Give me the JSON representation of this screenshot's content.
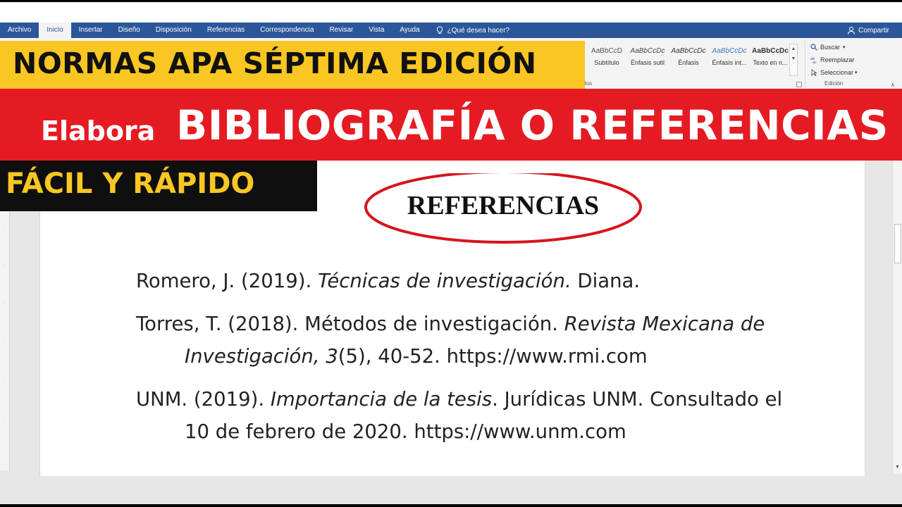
{
  "ribbon": {
    "tabs": [
      "Archivo",
      "Inicio",
      "Insertar",
      "Diseño",
      "Disposición",
      "Referencias",
      "Correspondencia",
      "Revisar",
      "Vista",
      "Ayuda"
    ],
    "active_tab": "Inicio",
    "tell_me": "¿Qué desea hacer?",
    "share": "Compartir",
    "styles": [
      {
        "sample": "AaBbCcD",
        "label": "Subtítulo"
      },
      {
        "sample": "AaBbCcDc",
        "label": "Énfasis sutil"
      },
      {
        "sample": "AaBbCcDc",
        "label": "Énfasis"
      },
      {
        "sample": "AaBbCcDc",
        "label": "Énfasis int..."
      },
      {
        "sample": "AaBbCcDc",
        "label": "Texto en n..."
      }
    ],
    "styles_group_label": "ilos",
    "editing": {
      "find": "Buscar",
      "replace": "Reemplazar",
      "select": "Seleccionar",
      "group_label": "Edición"
    }
  },
  "banners": {
    "line1": "NORMAS APA SÉPTIMA EDICIÓN",
    "line2_small": "Elabora",
    "line2_big": "BIBLIOGRAFÍA O REFERENCIAS",
    "line3": "FÁCIL Y RÁPIDO"
  },
  "document": {
    "heading": "REFERENCIAS",
    "references": [
      {
        "pre": "Romero, J. (2019). ",
        "italic": "Técnicas de investigación.",
        "post": " Diana."
      },
      {
        "pre": "Torres, T. (2018). Métodos de investigación. ",
        "italic": "Revista Mexicana de Investigación, 3",
        "post": "(5), 40-52. https://www.rmi.com"
      },
      {
        "pre": "UNM. (2019). ",
        "italic": "Importancia de la tesis",
        "post": ". Jurídicas UNM. Consultado el 10 de febrero de 2020. https://www.unm.com"
      }
    ]
  },
  "colors": {
    "ribbon_blue": "#2b579a",
    "banner_yellow": "#f9c623",
    "banner_red": "#e51b23",
    "ellipse_red": "#d7141e"
  }
}
